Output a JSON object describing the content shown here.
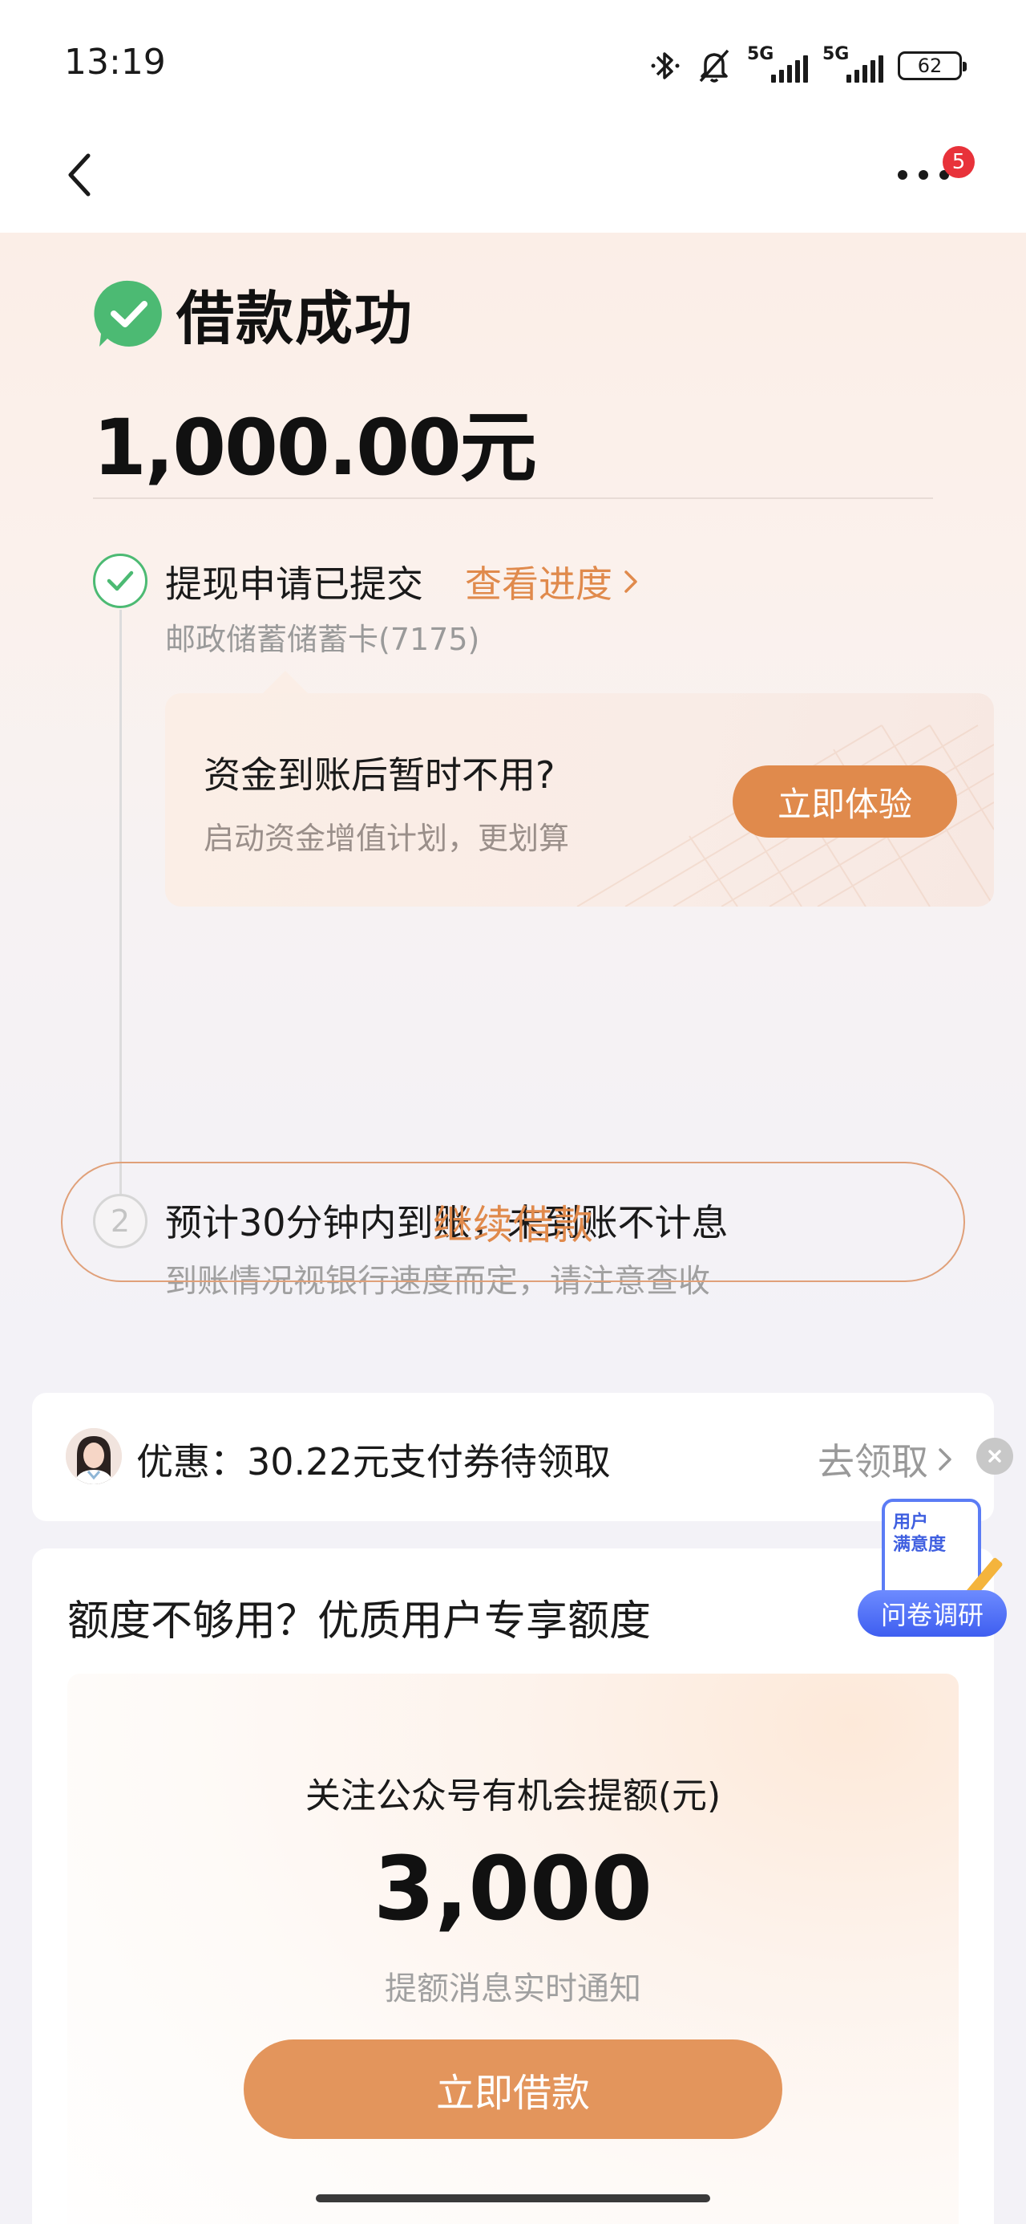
{
  "status_bar": {
    "time": "13:19",
    "signal1_label": "5G",
    "signal2_label": "5G",
    "battery": "62",
    "icons": [
      "bluetooth-icon",
      "mute-bell-icon",
      "signal-icon",
      "signal-icon",
      "battery-icon"
    ]
  },
  "nav": {
    "back_icon": "chevron-left-icon",
    "more_icon": "more-dots-icon",
    "badge_count": "5"
  },
  "result": {
    "title": "借款成功",
    "amount": "1,000.00元",
    "step1": {
      "title": "提现申请已提交",
      "link": "查看进度",
      "account": "邮政储蓄储蓄卡(7175)"
    },
    "promo": {
      "title": "资金到账后暂时不用?",
      "subtitle": "启动资金增值计划，更划算",
      "button": "立即体验"
    },
    "step2": {
      "number": "2",
      "title": "预计30分钟内到账，未到账不计息",
      "subtitle": "到账情况视银行速度而定，请注意查收"
    },
    "continue_button": "继续借款"
  },
  "coupon": {
    "text": "优惠：30.22元支付券待领取",
    "claim": "去领取"
  },
  "quota": {
    "heading": "额度不够用？优质用户专享额度",
    "label": "关注公众号有机会提额(元)",
    "amount": "3,000",
    "note": "提额消息实时通知",
    "button": "立即借款"
  },
  "survey": {
    "paper_line1": "用户",
    "paper_line2": "满意度",
    "label": "问卷调研"
  },
  "colors": {
    "accent": "#e08a4c",
    "success": "#4cba73",
    "badge": "#e8323a",
    "survey": "#4f6ef2"
  }
}
